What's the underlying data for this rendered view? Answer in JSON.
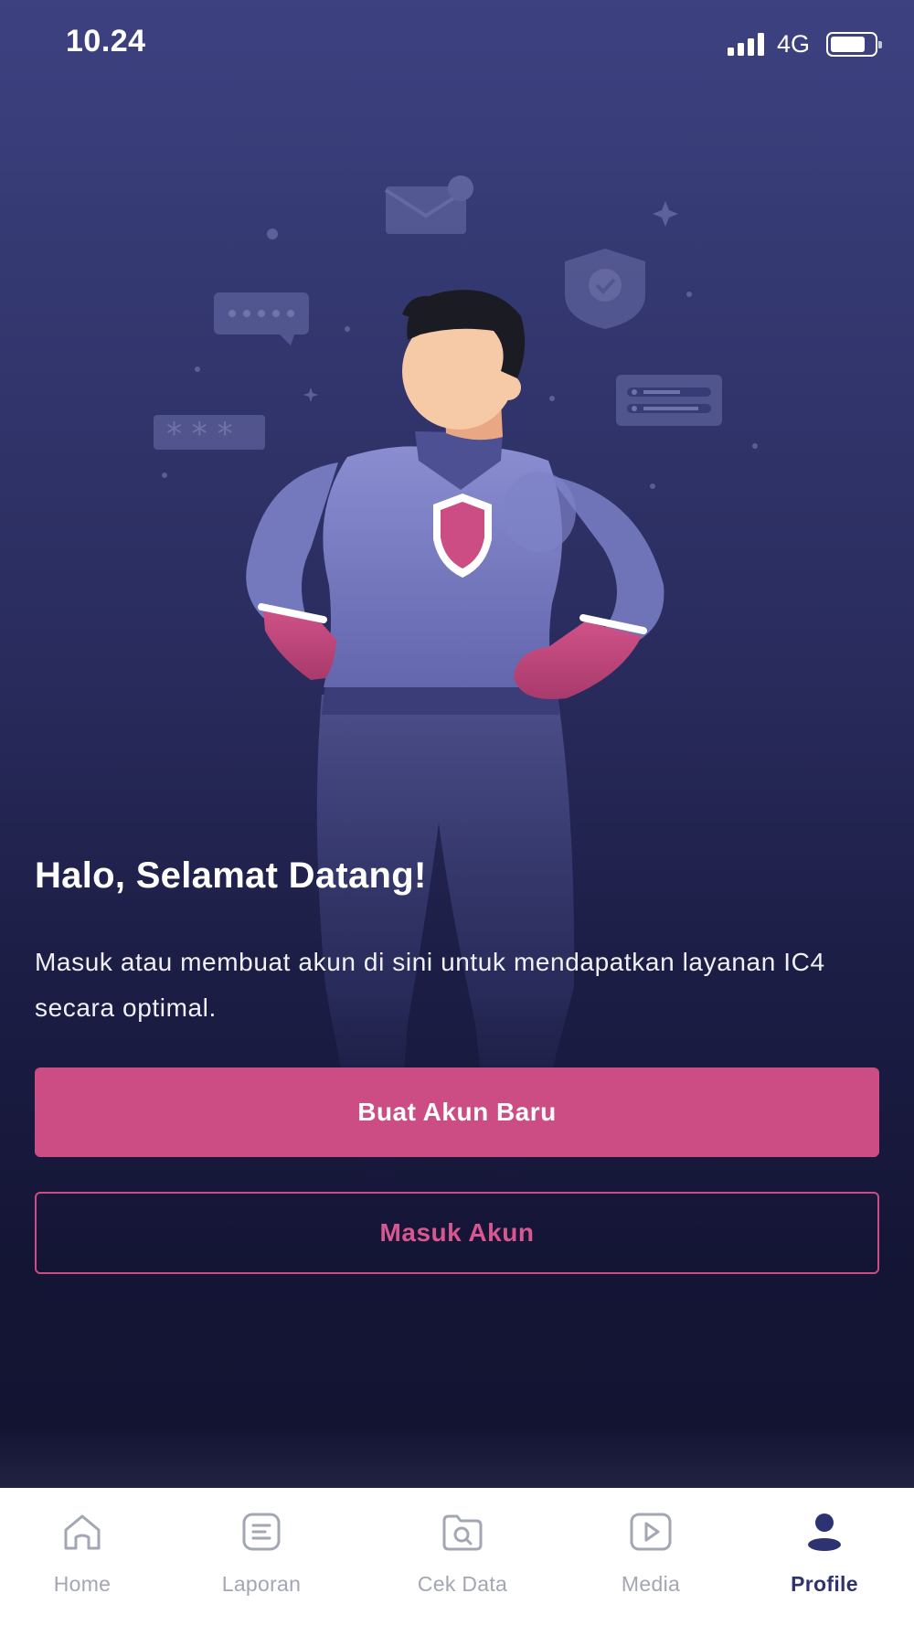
{
  "status_bar": {
    "time": "10.24",
    "network": "4G"
  },
  "welcome": {
    "title": "Halo, Selamat Datang!",
    "description": "Masuk atau membuat akun di sini untuk mendapatkan layanan IC4 secara optimal."
  },
  "buttons": {
    "create_account": "Buat Akun Baru",
    "login": "Masuk Akun"
  },
  "bottom_nav": {
    "items": [
      {
        "label": "Home",
        "icon": "home-icon",
        "active": false
      },
      {
        "label": "Laporan",
        "icon": "report-icon",
        "active": false
      },
      {
        "label": "Cek Data",
        "icon": "check-data-icon",
        "active": false
      },
      {
        "label": "Media",
        "icon": "media-play-icon",
        "active": false
      },
      {
        "label": "Profile",
        "icon": "profile-icon",
        "active": true
      }
    ]
  },
  "colors": {
    "accent": "#cb4d83",
    "background_top": "#3d4180",
    "background_bottom": "#12132f",
    "nav_active": "#2e3270",
    "nav_inactive": "#a3a6b3"
  }
}
